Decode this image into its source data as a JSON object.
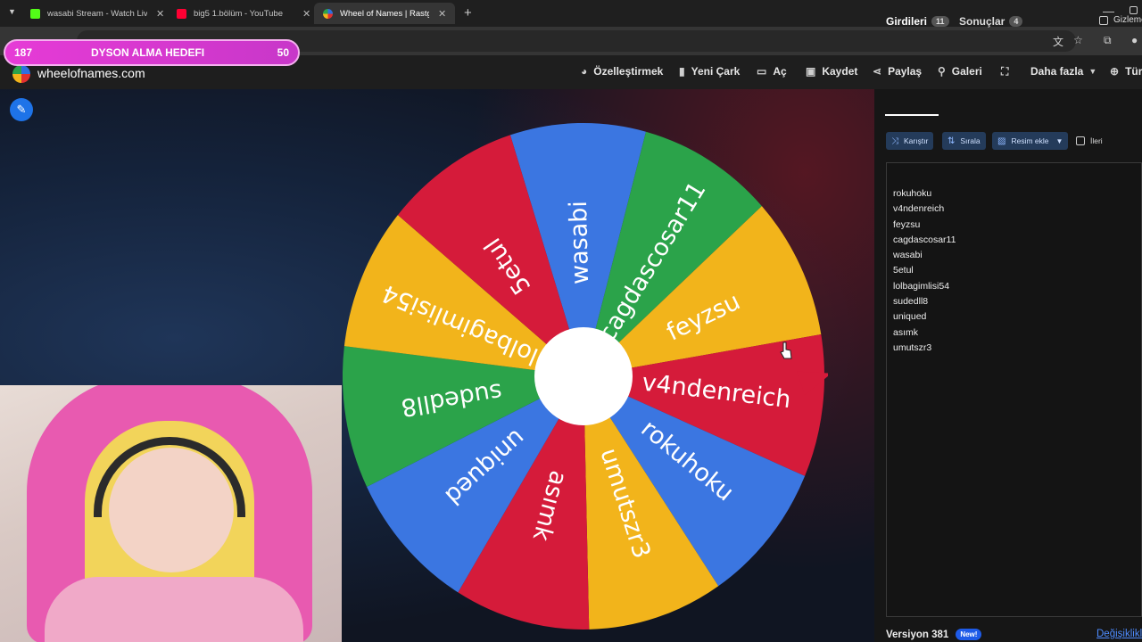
{
  "browser": {
    "tabs": [
      {
        "title": "wasabi Stream - Watch Live on",
        "favicon_color": "#53fc18",
        "active": false
      },
      {
        "title": "big5 1.bölüm - YouTube",
        "favicon_color": "#ff0033",
        "active": false
      },
      {
        "title": "Wheel of Names | Rastgele",
        "favicon_color": "#4a7bd8",
        "active": true
      }
    ],
    "close_glyph": "✕",
    "new_tab_glyph": "+"
  },
  "overlay_goal": {
    "left_value": "187",
    "label": "DYSON ALMA HEDEFI",
    "right_value": "50"
  },
  "site": {
    "name": "wheelofnames.com"
  },
  "nav": [
    {
      "label": "Özelleştirmek",
      "icon": "palette-icon"
    },
    {
      "label": "Yeni Çark",
      "icon": "document-icon"
    },
    {
      "label": "Aç",
      "icon": "folder-icon"
    },
    {
      "label": "Kaydet",
      "icon": "save-icon"
    },
    {
      "label": "Paylaş",
      "icon": "share-icon"
    },
    {
      "label": "Galeri",
      "icon": "search-icon"
    },
    {
      "label": "",
      "icon": "fullscreen-icon"
    },
    {
      "label": "Daha fazla",
      "icon": "chevron-down-icon"
    },
    {
      "label": "Tür",
      "icon": "globe-icon"
    }
  ],
  "wheel": {
    "slices": [
      {
        "name": "wasabi",
        "color": "#3b76e1"
      },
      {
        "name": "cagdascosar11",
        "color": "#2ba34a"
      },
      {
        "name": "feyzsu",
        "color": "#f2b41b"
      },
      {
        "name": "v4ndenreich",
        "color": "#d51b3a"
      },
      {
        "name": "rokuhoku",
        "color": "#3b76e1"
      },
      {
        "name": "umutszr3",
        "color": "#f2b41b"
      },
      {
        "name": "asımk",
        "color": "#d51b3a"
      },
      {
        "name": "uniqued",
        "color": "#3b76e1"
      },
      {
        "name": "sudedll8",
        "color": "#2ba34a"
      },
      {
        "name": "lolbagimlisi54",
        "color": "#f2b41b"
      },
      {
        "name": "5etul",
        "color": "#d51b3a"
      }
    ],
    "pointer_color": "#d51b3a"
  },
  "panel": {
    "tabs": [
      {
        "label": "Girdileri",
        "count": "11"
      },
      {
        "label": "Sonuçlar",
        "count": "4"
      }
    ],
    "hide_label": "Gizleme",
    "buttons": [
      {
        "label": "Karıştır",
        "icon": "shuffle-icon"
      },
      {
        "label": "Sırala",
        "icon": "sort-icon"
      },
      {
        "label": "Resim ekle",
        "icon": "image-icon"
      }
    ],
    "advanced_label": "İleri",
    "entries": [
      "rokuhoku",
      "v4ndenreich",
      "feyzsu",
      "cagdascosar11",
      "wasabi",
      "5etul",
      "lolbagimlisi54",
      "sudedll8",
      "uniqued",
      "asımk",
      "umutszr3"
    ],
    "version_label": "Versiyon 381",
    "new_badge": "New!",
    "changes_link": "Değişiklikler"
  }
}
